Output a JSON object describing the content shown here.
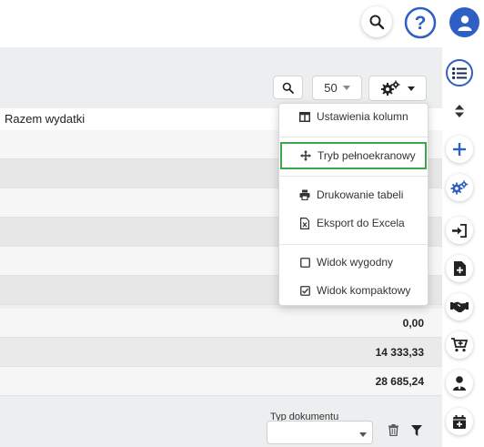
{
  "table": {
    "header": "Razem wydatki",
    "rows": [
      {
        "value": ""
      },
      {
        "value": ""
      },
      {
        "value": ""
      },
      {
        "value": ""
      },
      {
        "value": ""
      },
      {
        "value": ""
      },
      {
        "value": "0,00"
      },
      {
        "value": "14 333,33"
      },
      {
        "value": "28 685,24"
      }
    ]
  },
  "toolbar": {
    "page_size": "50"
  },
  "dropdown": {
    "items": [
      {
        "label": "Ustawienia kolumn",
        "icon": "columns-icon"
      },
      {
        "label": "Tryb pełnoekranowy",
        "icon": "move-arrows-icon"
      },
      {
        "label": "Drukowanie tabeli",
        "icon": "printer-icon"
      },
      {
        "label": "Eksport do Excela",
        "icon": "excel-file-icon"
      },
      {
        "label": "Widok wygodny",
        "icon": "checkbox-empty-icon"
      },
      {
        "label": "Widok kompaktowy",
        "icon": "checkbox-checked-icon"
      }
    ]
  },
  "filters": {
    "document_type_label": "Typ dokumentu"
  },
  "colors": {
    "accent": "#2f5fc4",
    "highlight": "#3aa74a"
  }
}
